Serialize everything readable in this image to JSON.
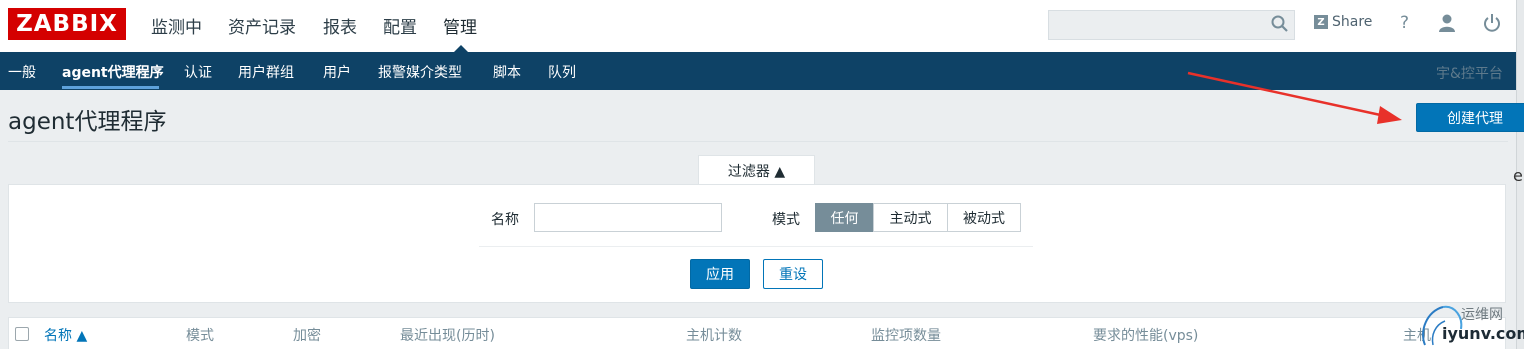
{
  "header": {
    "logo": "ZABBIX",
    "nav": [
      "监测中",
      "资产记录",
      "报表",
      "配置",
      "管理"
    ],
    "active_nav": "管理",
    "search": {
      "value": "",
      "placeholder": ""
    },
    "share_label": "Share",
    "help_label": "?",
    "icons": [
      "search-icon",
      "share-icon",
      "help-icon",
      "user-icon",
      "power-icon"
    ]
  },
  "subnav": {
    "items": [
      "一般",
      "agent代理程序",
      "认证",
      "用户群组",
      "用户",
      "报警媒介类型",
      "脚本",
      "队列"
    ],
    "active": "agent代理程序",
    "brand": "宇&控平台"
  },
  "page": {
    "title": "agent代理程序",
    "create_button": "创建代理"
  },
  "filter": {
    "tab_label": "过滤器 ▲",
    "name_label": "名称",
    "name_value": "",
    "mode_label": "模式",
    "mode_options": [
      "任何",
      "主动式",
      "被动式"
    ],
    "mode_selected": "任何",
    "apply_label": "应用",
    "reset_label": "重设"
  },
  "table": {
    "columns": [
      "名称 ▲",
      "模式",
      "加密",
      "最近出现(历时)",
      "主机计数",
      "监控项数量",
      "要求的性能(vps)",
      "主机"
    ]
  },
  "edge_text": "e",
  "watermark": {
    "top": "运维网",
    "bottom": "iyunv.com"
  },
  "colors": {
    "logo_red": "#d40000",
    "subnav_blue": "#0e4266",
    "primary_blue": "#0275b8",
    "selected_gray": "#768d99",
    "arrow_red": "#e8312a"
  }
}
